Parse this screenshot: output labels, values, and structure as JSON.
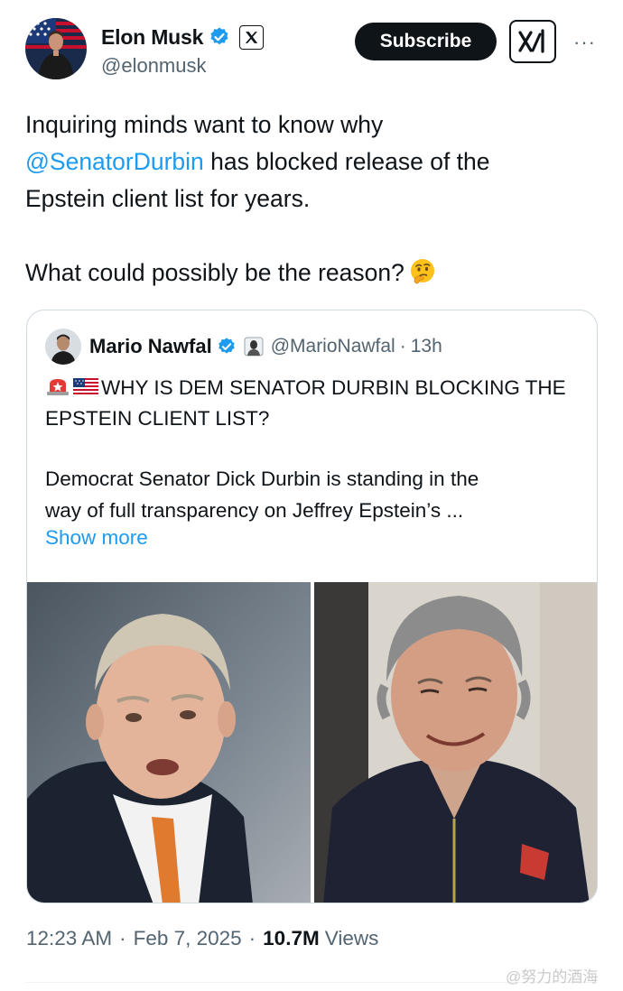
{
  "author": {
    "name": "Elon Musk",
    "handle": "@elonmusk",
    "verified_color": "#1d9bf0",
    "affiliate_badge_icon": "x-logo-icon"
  },
  "actions": {
    "subscribe_label": "Subscribe",
    "grok_icon": "xai-logo-icon",
    "more_label": "···"
  },
  "tweet": {
    "line1": "Inquiring minds want to know why",
    "mention": "@SenatorDurbin",
    "line2_rest": " has blocked release of the",
    "line3": "Epstein client list for years.",
    "line4": "What could possibly be the reason?",
    "emoji": "thinking-face-icon"
  },
  "quote": {
    "name": "Mario Nawfal",
    "handle": "@MarioNawfal",
    "separator": "·",
    "time": "13h",
    "headline_emojis": [
      "rotating-light-icon",
      "us-flag-icon"
    ],
    "headline": "WHY IS DEM SENATOR DURBIN BLOCKING THE EPSTEIN CLIENT LIST?",
    "body_line1": "Democrat Senator Dick Durbin is standing in the",
    "body_line2": "way of full transparency on Jeffrey Epstein’s ...",
    "show_more": "Show more"
  },
  "footer": {
    "time": "12:23 AM",
    "sep": "·",
    "date": "Feb 7, 2025",
    "views_count": "10.7M",
    "views_label": "Views"
  },
  "watermark": "@努力的酒海",
  "colors": {
    "accent": "#1d9bf0",
    "text": "#0f1419",
    "muted": "#536471",
    "border": "#cfd9de"
  }
}
